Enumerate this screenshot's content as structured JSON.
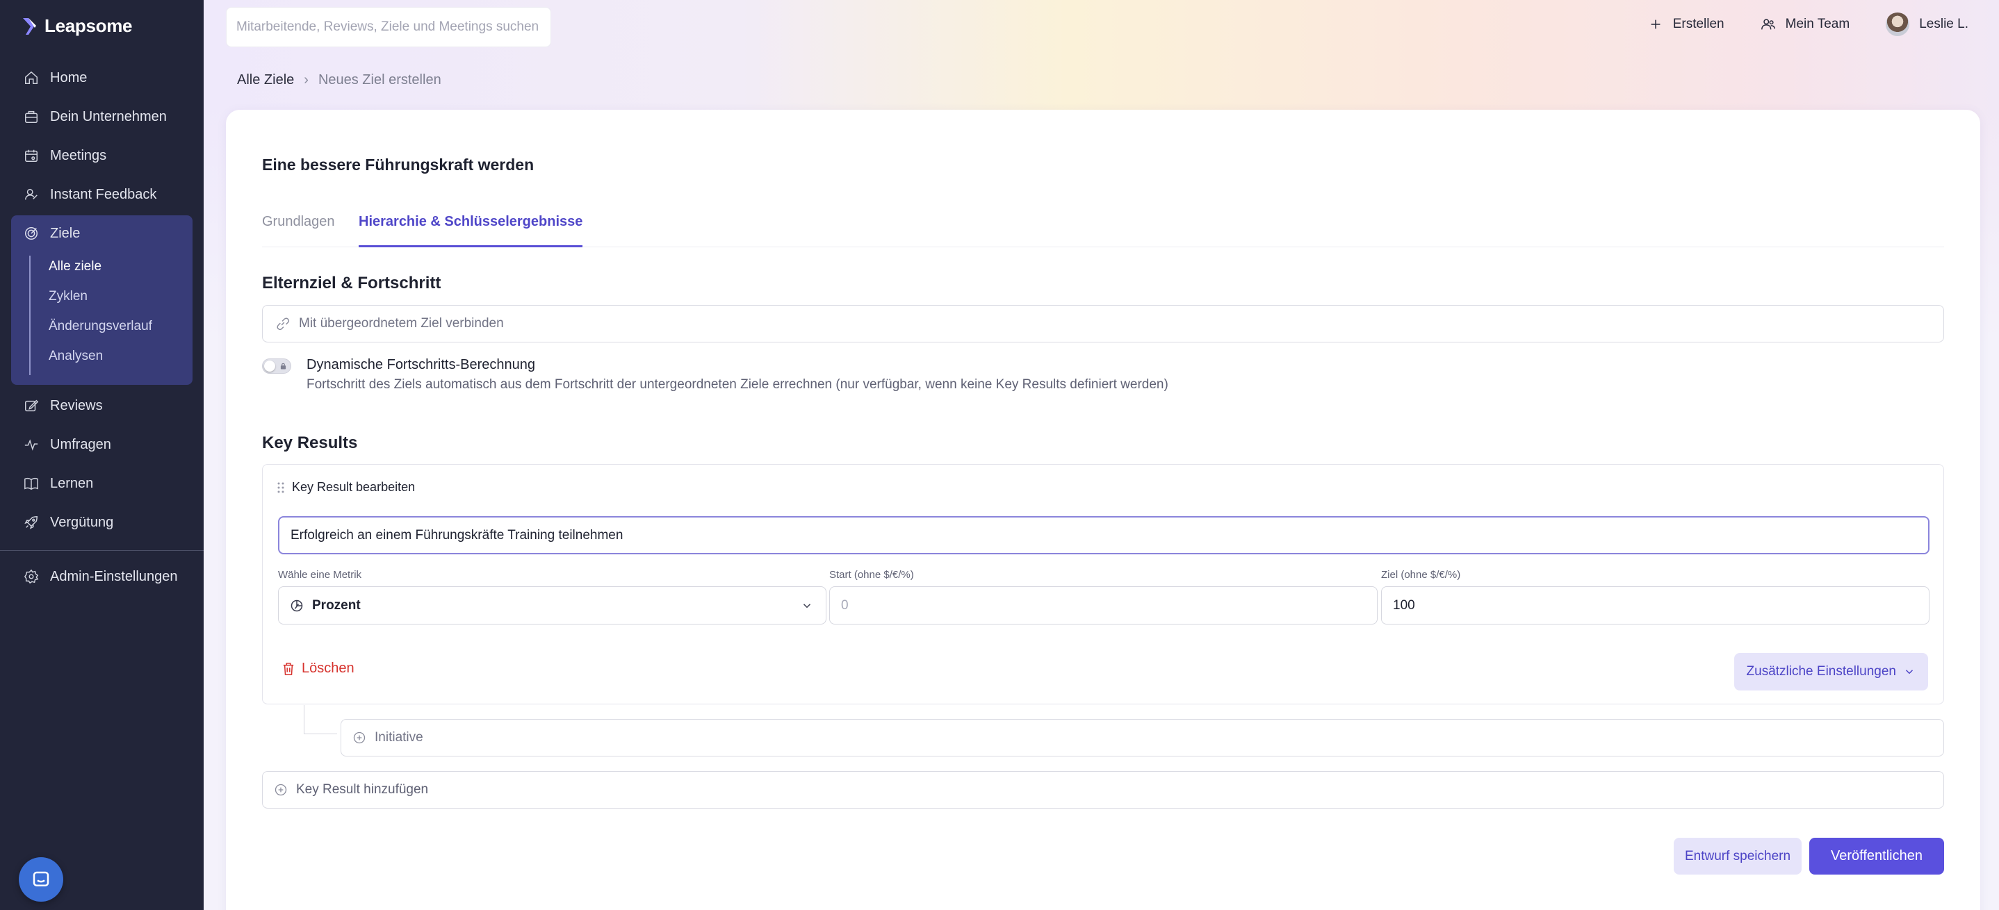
{
  "brand": {
    "name": "Leapsome"
  },
  "sidebar": {
    "items": [
      {
        "label": "Home",
        "icon": "home-icon"
      },
      {
        "label": "Dein Unternehmen",
        "icon": "building-icon"
      },
      {
        "label": "Meetings",
        "icon": "calendar-icon"
      },
      {
        "label": "Instant Feedback",
        "icon": "feedback-icon"
      },
      {
        "label": "Ziele",
        "icon": "target-icon"
      },
      {
        "label": "Reviews",
        "icon": "edit-icon"
      },
      {
        "label": "Umfragen",
        "icon": "pulse-icon"
      },
      {
        "label": "Lernen",
        "icon": "book-icon"
      },
      {
        "label": "Vergütung",
        "icon": "rocket-icon"
      }
    ],
    "sub_items": [
      "Alle ziele",
      "Zyklen",
      "Änderungsverlauf",
      "Analysen"
    ],
    "admin": {
      "label": "Admin-Einstellungen",
      "icon": "gear-icon"
    }
  },
  "topbar": {
    "search_placeholder": "Mitarbeitende, Reviews, Ziele und Meetings suchen",
    "create_label": "Erstellen",
    "team_label": "Mein Team",
    "user_label": "Leslie L."
  },
  "breadcrumb": {
    "parent": "Alle Ziele",
    "current": "Neues Ziel erstellen"
  },
  "goal": {
    "title": "Eine bessere Führungskraft werden",
    "tabs": [
      "Grundlagen",
      "Hierarchie & Schlüsselergebnisse"
    ],
    "active_tab": "Hierarchie & Schlüsselergebnisse"
  },
  "parent_section": {
    "heading": "Elternziel & Fortschritt",
    "link_placeholder": "Mit übergeordnetem Ziel verbinden",
    "toggle_label": "Dynamische Fortschritts-Berechnung",
    "toggle_desc": "Fortschritt des Ziels automatisch aus dem Fortschritt der untergeordneten Ziele errechnen (nur verfügbar, wenn keine Key Results definiert werden)",
    "toggle_on": false
  },
  "key_results": {
    "heading": "Key Results",
    "edit_label": "Key Result bearbeiten",
    "title_value": "Erfolgreich an einem Führungskräfte Training teilnehmen",
    "metric_label": "Wähle eine Metrik",
    "metric_value": "Prozent",
    "start_label": "Start (ohne $/€/%)",
    "start_placeholder": "0",
    "target_label": "Ziel (ohne $/€/%)",
    "target_value": "100",
    "delete_label": "Löschen",
    "extra_label": "Zusätzliche Einstellungen",
    "initiative_label": "Initiative",
    "add_label": "Key Result hinzufügen"
  },
  "footer": {
    "draft_label": "Entwurf speichern",
    "publish_label": "Veröffentlichen"
  },
  "colors": {
    "sidebar_bg": "#222539",
    "accent": "#5a50de",
    "danger": "#d6322d",
    "nav_active_bg": "#383c78"
  }
}
